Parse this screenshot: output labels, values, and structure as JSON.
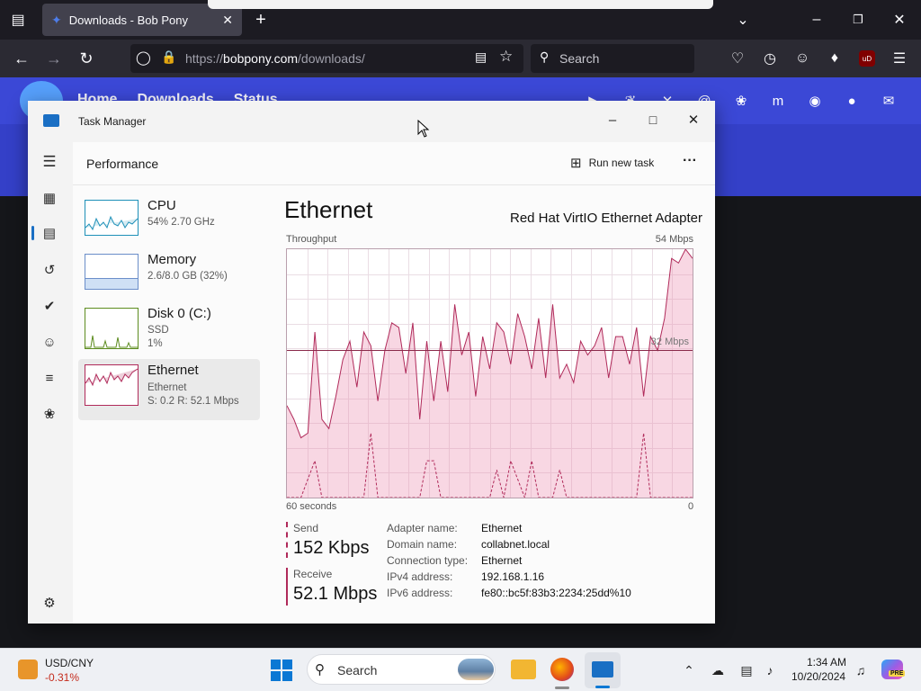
{
  "browser": {
    "tab_title": "Downloads - Bob Pony",
    "url_prefix": "https://",
    "url_host": "bobpony.com",
    "url_path": "/downloads/",
    "search_placeholder": "Search",
    "ublock_label": "uD"
  },
  "website": {
    "nav": [
      "Home",
      "Downloads",
      "Status"
    ]
  },
  "task_manager": {
    "window_title": "Task Manager",
    "page_title": "Performance",
    "run_new_task": "Run new task",
    "more": "···",
    "resources": [
      {
        "name": "CPU",
        "line1": "54%  2.70 GHz",
        "line2": "",
        "line3": ""
      },
      {
        "name": "Memory",
        "line1": "2.6/8.0 GB (32%)",
        "line2": "",
        "line3": ""
      },
      {
        "name": "Disk 0 (C:)",
        "line1": "SSD",
        "line2": "1%",
        "line3": ""
      },
      {
        "name": "Ethernet",
        "line1": "Ethernet",
        "line2": "S: 0.2  R: 52.1 Mbps",
        "line3": ""
      }
    ],
    "detail": {
      "title": "Ethernet",
      "adapter": "Red Hat VirtIO Ethernet Adapter",
      "throughput_label": "Throughput",
      "max_label": "54 Mbps",
      "mid_label": "32 Mbps",
      "time_left": "60 seconds",
      "time_right": "0",
      "send_label": "Send",
      "send_value": "152 Kbps",
      "receive_label": "Receive",
      "receive_value": "52.1 Mbps",
      "properties": [
        {
          "k": "Adapter name:",
          "v": "Ethernet"
        },
        {
          "k": "Domain name:",
          "v": "collabnet.local"
        },
        {
          "k": "Connection type:",
          "v": "Ethernet"
        },
        {
          "k": "IPv4 address:",
          "v": "192.168.1.16"
        },
        {
          "k": "IPv6 address:",
          "v": "fe80::bc5f:83b3:2234:25dd%10"
        }
      ]
    }
  },
  "chart_data": {
    "type": "area",
    "title": "Throughput",
    "ylim": [
      0,
      54
    ],
    "unit": "Mbps",
    "reference_line": 32,
    "series": [
      {
        "name": "Receive",
        "color": "#b02a5a",
        "values": [
          20,
          17,
          13,
          14,
          36,
          17,
          15,
          22,
          30,
          34,
          24,
          36,
          33,
          21,
          32,
          38,
          37,
          27,
          38,
          17,
          34,
          21,
          34,
          23,
          42,
          31,
          36,
          22,
          35,
          28,
          38,
          36,
          29,
          40,
          35,
          28,
          39,
          26,
          42,
          26,
          29,
          25,
          34,
          31,
          33,
          37,
          26,
          35,
          35,
          29,
          37,
          22,
          35,
          32,
          39,
          52,
          51,
          54,
          52
        ]
      },
      {
        "name": "Send",
        "color": "#b02a5a",
        "dashed": true,
        "values": [
          0,
          0,
          0,
          4,
          8,
          0,
          0,
          0,
          0,
          0,
          0,
          0,
          14,
          0,
          0,
          0,
          0,
          0,
          0,
          0,
          8,
          8,
          0,
          0,
          0,
          0,
          0,
          0,
          0,
          0,
          6,
          0,
          8,
          4,
          0,
          8,
          0,
          0,
          0,
          6,
          0,
          0,
          0,
          0,
          0,
          0,
          0,
          0,
          0,
          0,
          0,
          14,
          0,
          0,
          0,
          0,
          0,
          0,
          0
        ]
      }
    ]
  },
  "taskbar": {
    "currency_pair": "USD/CNY",
    "currency_change": "-0.31%",
    "search_label": "Search",
    "time": "1:34 AM",
    "date": "10/20/2024",
    "copilot_badge": "PRE"
  },
  "colors": {
    "accent_ethernet": "#b02a5a",
    "cpu": "#1e90b8",
    "memory": "#6b8ec9",
    "disk": "#5d8c1f",
    "site_blue": "#3b48d6"
  }
}
